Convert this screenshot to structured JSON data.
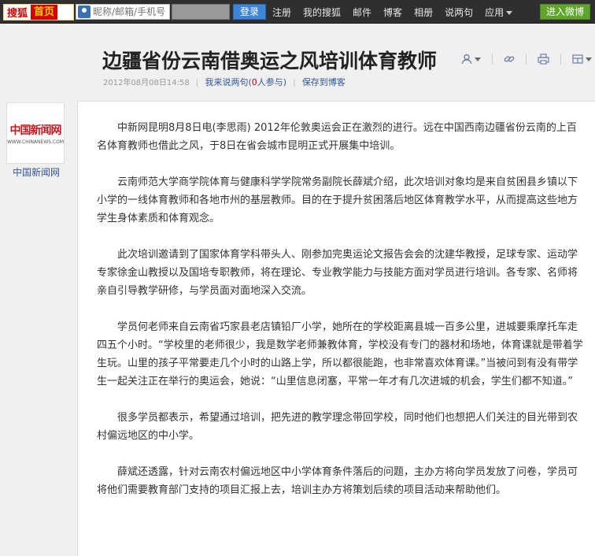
{
  "topbar": {
    "brand": "搜狐",
    "home": "首页",
    "login_placeholder": "昵称/邮箱/手机号",
    "login_button": "登录",
    "nav": [
      {
        "label": "注册",
        "caret": false
      },
      {
        "label": "我的搜狐",
        "caret": false
      },
      {
        "label": "邮件",
        "caret": false
      },
      {
        "label": "博客",
        "caret": false
      },
      {
        "label": "相册",
        "caret": false
      },
      {
        "label": "说两句",
        "caret": false
      },
      {
        "label": "应用",
        "caret": true
      }
    ],
    "weibo_button": "进入微博"
  },
  "article": {
    "title": "边疆省份云南借奥运之风培训体育教师",
    "date": "2012年08月08日14:58",
    "comment_label": "我来说两句",
    "comment_count_prefix": "(",
    "comment_count": "0",
    "comment_count_suffix": "人参与)",
    "save_label": "保存到博客",
    "paragraphs": [
      "中新网昆明8月8日电(李思雨) 2012年伦敦奥运会正在激烈的进行。远在中国西南边疆省份云南的上百名体育教师也借此之风，于8日在省会城市昆明正式开展集中培训。",
      "云南师范大学商学院体育与健康科学学院常务副院长薛斌介绍，此次培训对象均是来自贫困县乡镇以下小学的一线体育教师和各地市州的基层教师。目的在于提升贫困落后地区体育教学水平，从而提高这些地方学生身体素质和体育观念。",
      "此次培训邀请到了国家体育学科带头人、刚参加完奥运论文报告会会的沈建华教授，足球专家、运动学专家徐金山教授以及国培专职教师，将在理论、专业教学能力与技能方面对学员进行培训。各专家、名师将亲自引导教学研修，与学员面对面地深入交流。",
      "学员何老师来自云南省巧家县老店镇铅厂小学，她所在的学校距离县城一百多公里，进城要乘摩托车走四五个小时。“学校里的老师很少，我是数学老师兼教体育，学校没有专门的器材和场地，体育课就是带着学生玩。山里的孩子平常要走几个小时的山路上学，所以都很能跑，也非常喜欢体育课。”当被问到有没有带学生一起关注正在举行的奥运会，她说：“山里信息闭塞，平常一年才有几次进城的机会，学生们都不知道。”",
      "很多学员都表示，希望通过培训，把先进的教学理念带回学校，同时他们也想把人们关注的目光带到农村偏远地区的中小学。",
      "薛斌还透露，针对云南农村偏远地区中小学体育条件落后的问题，主办方将向学员发放了问卷，学员可将他们需要教育部门支持的项目汇报上去，培训主办方将策划后续的项目活动来帮助他们。"
    ]
  },
  "author": {
    "logo_cn": "中国新闻网",
    "logo_en": "WWW.CHINANEWS.COM",
    "name": "中国新闻网"
  },
  "icons": {
    "user": "user-icon",
    "link": "link-icon",
    "print": "print-icon",
    "layout": "layout-icon"
  },
  "colors": {
    "topbar": "#2f2f2f",
    "login_button": "#3d85d8",
    "weibo_button": "#5fa52c",
    "link": "#335599",
    "count": "#cc0000"
  }
}
